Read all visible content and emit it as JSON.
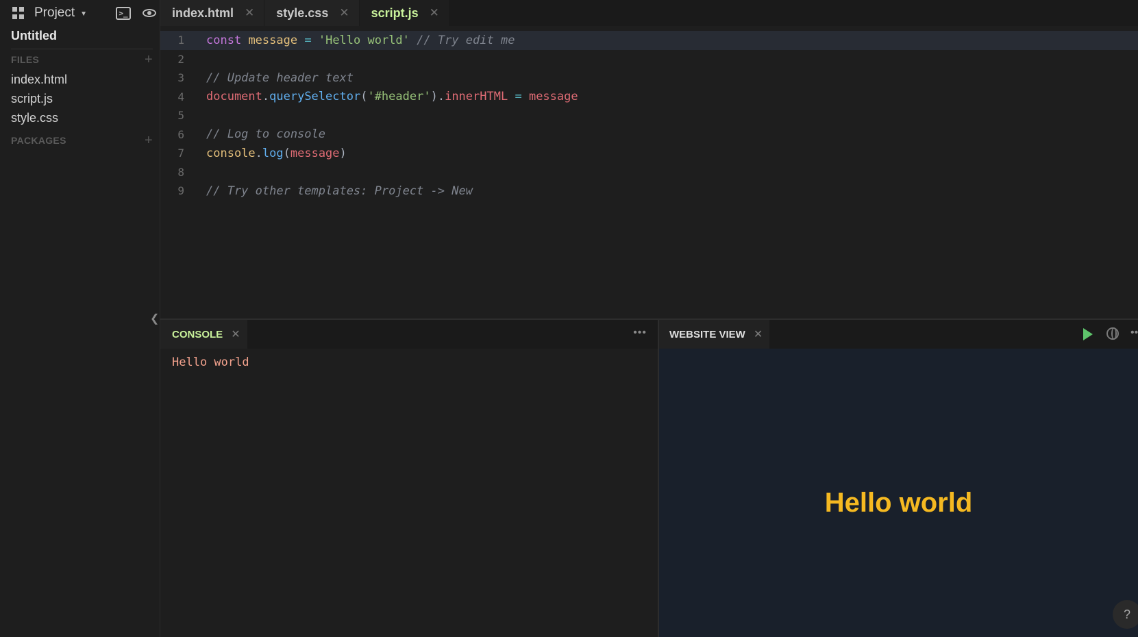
{
  "sidebar": {
    "project_label": "Project",
    "project_title": "Untitled",
    "files_heading": "FILES",
    "files": [
      "index.html",
      "script.js",
      "style.css"
    ],
    "packages_heading": "PACKAGES",
    "add_symbol": "+",
    "collapse_symbol": "❮"
  },
  "tabs": [
    {
      "label": "index.html",
      "active": false
    },
    {
      "label": "style.css",
      "active": false
    },
    {
      "label": "script.js",
      "active": true
    }
  ],
  "tab_close": "✕",
  "editor": {
    "line_numbers": [
      "1",
      "2",
      "3",
      "4",
      "5",
      "6",
      "7",
      "8",
      "9"
    ],
    "code": {
      "l1": {
        "kw": "const",
        "var": "message",
        "op": "=",
        "str": "'Hello world'",
        "cm": "// Try edit me"
      },
      "l3": {
        "cm": "// Update header text"
      },
      "l4": {
        "obj": "document",
        "dot1": ".",
        "fn": "querySelector",
        "p1": "(",
        "str": "'#header'",
        "p2": ")",
        "dot2": ".",
        "prop": "innerHTML",
        "op": "=",
        "val": "message"
      },
      "l6": {
        "cm": "// Log to console"
      },
      "l7": {
        "obj": "console",
        "dot": ".",
        "fn": "log",
        "p1": "(",
        "arg": "message",
        "p2": ")"
      },
      "l9": {
        "cm": "// Try other templates: Project -> New"
      }
    }
  },
  "console": {
    "tab_label": "CONSOLE",
    "output": "Hello world",
    "menu": "•••"
  },
  "website_view": {
    "tab_label": "WEBSITE VIEW",
    "heading": "Hello world",
    "menu": "•••",
    "help": "?"
  },
  "colors": {
    "accent_green": "#c9f29b",
    "heading_yellow": "#f5b921",
    "play_green": "#5ec46b"
  }
}
